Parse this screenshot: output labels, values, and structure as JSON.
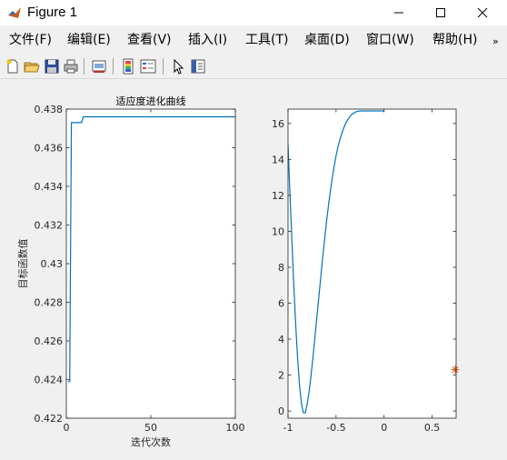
{
  "window": {
    "title": "Figure 1",
    "controls": {
      "minimize": "—",
      "maximize": "☐",
      "close": "✕"
    }
  },
  "menu": {
    "items": [
      "文件(F)",
      "编辑(E)",
      "查看(V)",
      "插入(I)",
      "工具(T)",
      "桌面(D)",
      "窗口(W)",
      "帮助(H)"
    ],
    "overflow": "»"
  },
  "toolbar": {
    "icons": [
      "new-figure-icon",
      "open-file-icon",
      "save-icon",
      "print-icon",
      "link-plot-icon",
      "colorbar-icon",
      "legend-icon",
      "pointer-icon",
      "property-inspector-icon"
    ]
  },
  "chart_data": [
    {
      "type": "line",
      "title": "适应度进化曲线",
      "xlabel": "迭代次数",
      "ylabel": "目标函数值",
      "xlim": [
        0,
        100
      ],
      "ylim": [
        0.422,
        0.438
      ],
      "xticks": [
        "0",
        "50",
        "100"
      ],
      "yticks": [
        "0.422",
        "0.424",
        "0.426",
        "0.428",
        "0.43",
        "0.432",
        "0.434",
        "0.436",
        "0.438"
      ],
      "grid": false,
      "series": [
        {
          "color": "#0072bd",
          "x": [
            1,
            2,
            3,
            4,
            5,
            6,
            7,
            8,
            9,
            10,
            11,
            100
          ],
          "y": [
            0.4239,
            0.4239,
            0.4373,
            0.4373,
            0.4373,
            0.4373,
            0.4373,
            0.4373,
            0.4373,
            0.4376,
            0.4376,
            0.4376
          ]
        }
      ]
    },
    {
      "type": "line",
      "title": "",
      "xlabel": "",
      "ylabel": "",
      "xlim": [
        -1,
        0.75
      ],
      "ylim": [
        -0.4,
        16.8
      ],
      "xticks": [
        "-1",
        "-0.5",
        "0",
        "0.5"
      ],
      "yticks": [
        "0",
        "2",
        "4",
        "6",
        "8",
        "10",
        "12",
        "14",
        "16"
      ],
      "grid": false,
      "series": [
        {
          "color": "#0072bd",
          "x": [
            -1.0,
            -0.98,
            -0.96,
            -0.94,
            -0.92,
            -0.9,
            -0.88,
            -0.86,
            -0.84,
            -0.82,
            -0.8,
            -0.78,
            -0.76,
            -0.74,
            -0.72,
            -0.7,
            -0.68,
            -0.66,
            -0.64,
            -0.62,
            -0.6,
            -0.58,
            -0.56,
            -0.54,
            -0.52,
            -0.5,
            -0.48,
            -0.46,
            -0.44,
            -0.42,
            -0.4,
            -0.38,
            -0.36,
            -0.34,
            -0.32,
            -0.3,
            -0.28,
            -0.26,
            -0.24,
            -0.22,
            -0.2,
            -0.18,
            -0.16,
            -0.14,
            -0.12,
            -0.1,
            -0.08,
            -0.06,
            -0.04,
            -0.02,
            0.0
          ],
          "y": [
            14.8,
            12.1,
            9.5,
            7.0,
            4.8,
            2.9,
            1.4,
            0.4,
            -0.1,
            -0.1,
            0.4,
            1.1,
            2.0,
            3.0,
            4.1,
            5.2,
            6.3,
            7.4,
            8.5,
            9.5,
            10.5,
            11.4,
            12.2,
            12.95,
            13.6,
            14.2,
            14.7,
            15.1,
            15.45,
            15.75,
            16.0,
            16.2,
            16.36,
            16.48,
            16.57,
            16.63,
            16.67,
            16.69,
            16.7,
            16.7,
            16.7,
            16.7,
            16.7,
            16.7,
            16.7,
            16.7,
            16.7,
            16.7,
            16.7,
            16.7,
            16.7
          ]
        },
        {
          "color": "#d95319",
          "marker": "*",
          "x": [
            0.74
          ],
          "y": [
            2.3
          ]
        }
      ]
    }
  ]
}
